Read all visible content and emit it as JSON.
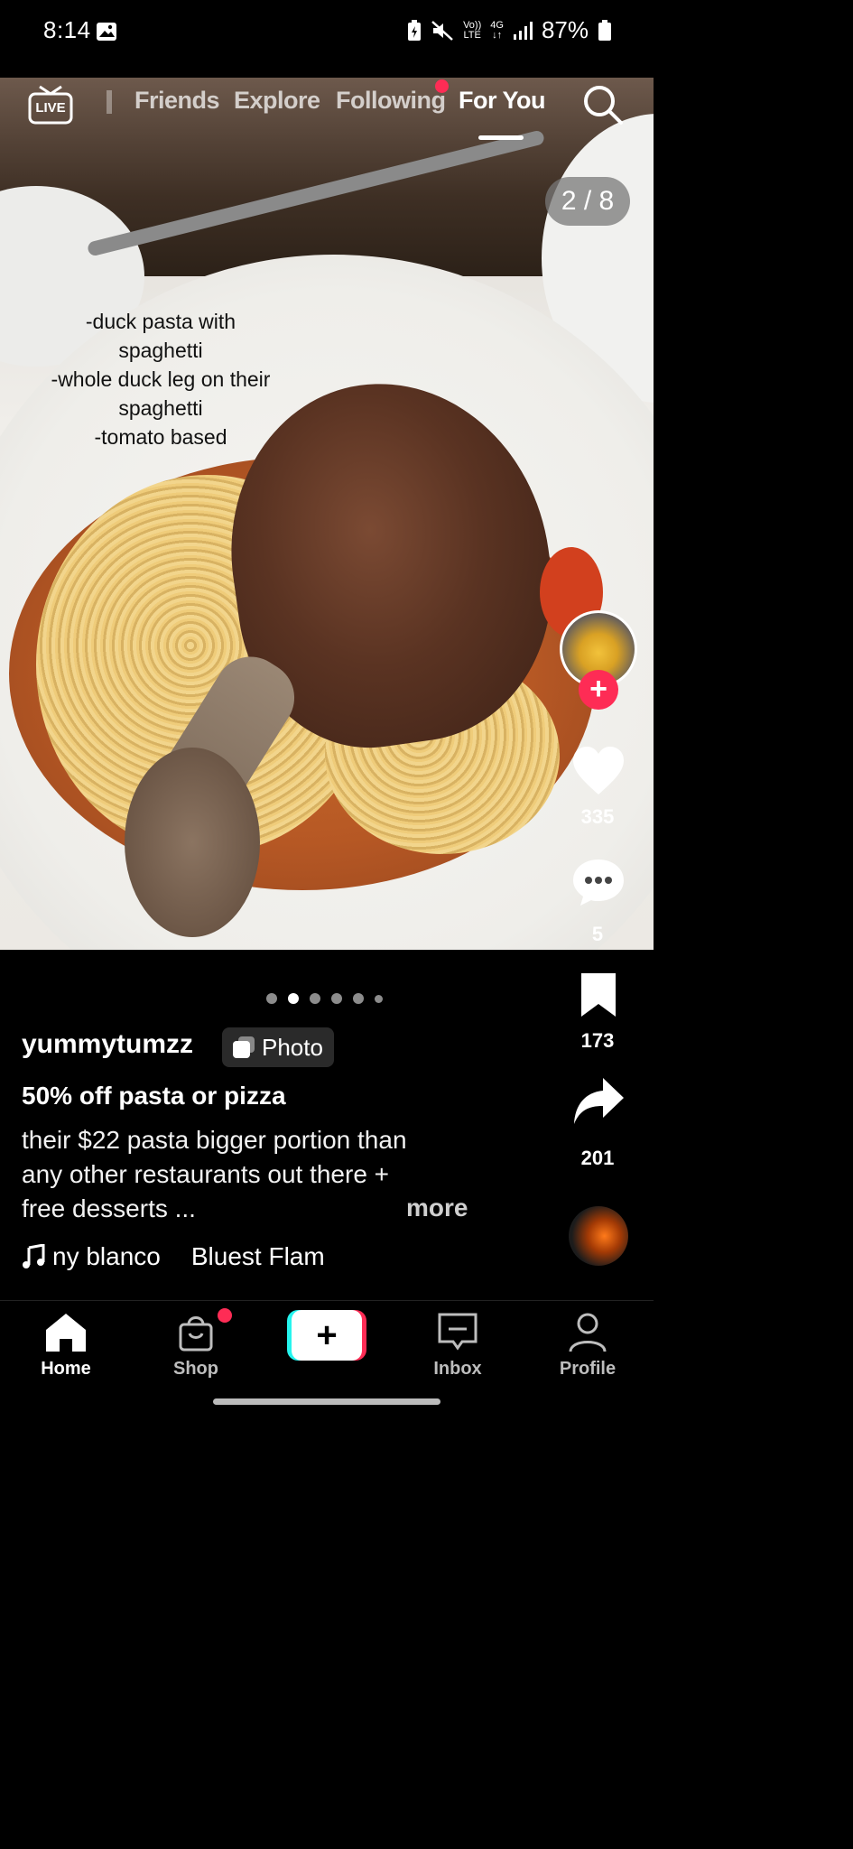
{
  "status_bar": {
    "time": "8:14",
    "network_top": "Vo))",
    "network_bottom": "LTE",
    "signal_top": "4G",
    "battery": "87%"
  },
  "top_nav": {
    "live_label": "LIVE",
    "tabs": [
      {
        "label": "Friends"
      },
      {
        "label": "Explore"
      },
      {
        "label": "Following"
      },
      {
        "label": "For You"
      }
    ]
  },
  "photo": {
    "counter": "2 / 8",
    "overlay_lines": [
      "-duck pasta with",
      "spaghetti",
      "-whole duck leg on their",
      "spaghetti",
      "-tomato based"
    ]
  },
  "right_rail": {
    "likes": "335",
    "comments": "5",
    "saves": "173",
    "shares": "201"
  },
  "post": {
    "username": "yummytumzz",
    "badge_label": "Photo",
    "title": "50% off pasta or pizza",
    "caption_lines": [
      "their $22 pasta bigger portion than",
      "any other restaurants out there +",
      "free desserts ..."
    ],
    "more_label": "more",
    "music_artist": "ny blanco",
    "music_title": "Bluest Flam"
  },
  "bottom_nav": {
    "home": "Home",
    "shop": "Shop",
    "inbox": "Inbox",
    "profile": "Profile"
  },
  "colors": {
    "accent": "#fe2c55",
    "cyan": "#25f4ee"
  }
}
